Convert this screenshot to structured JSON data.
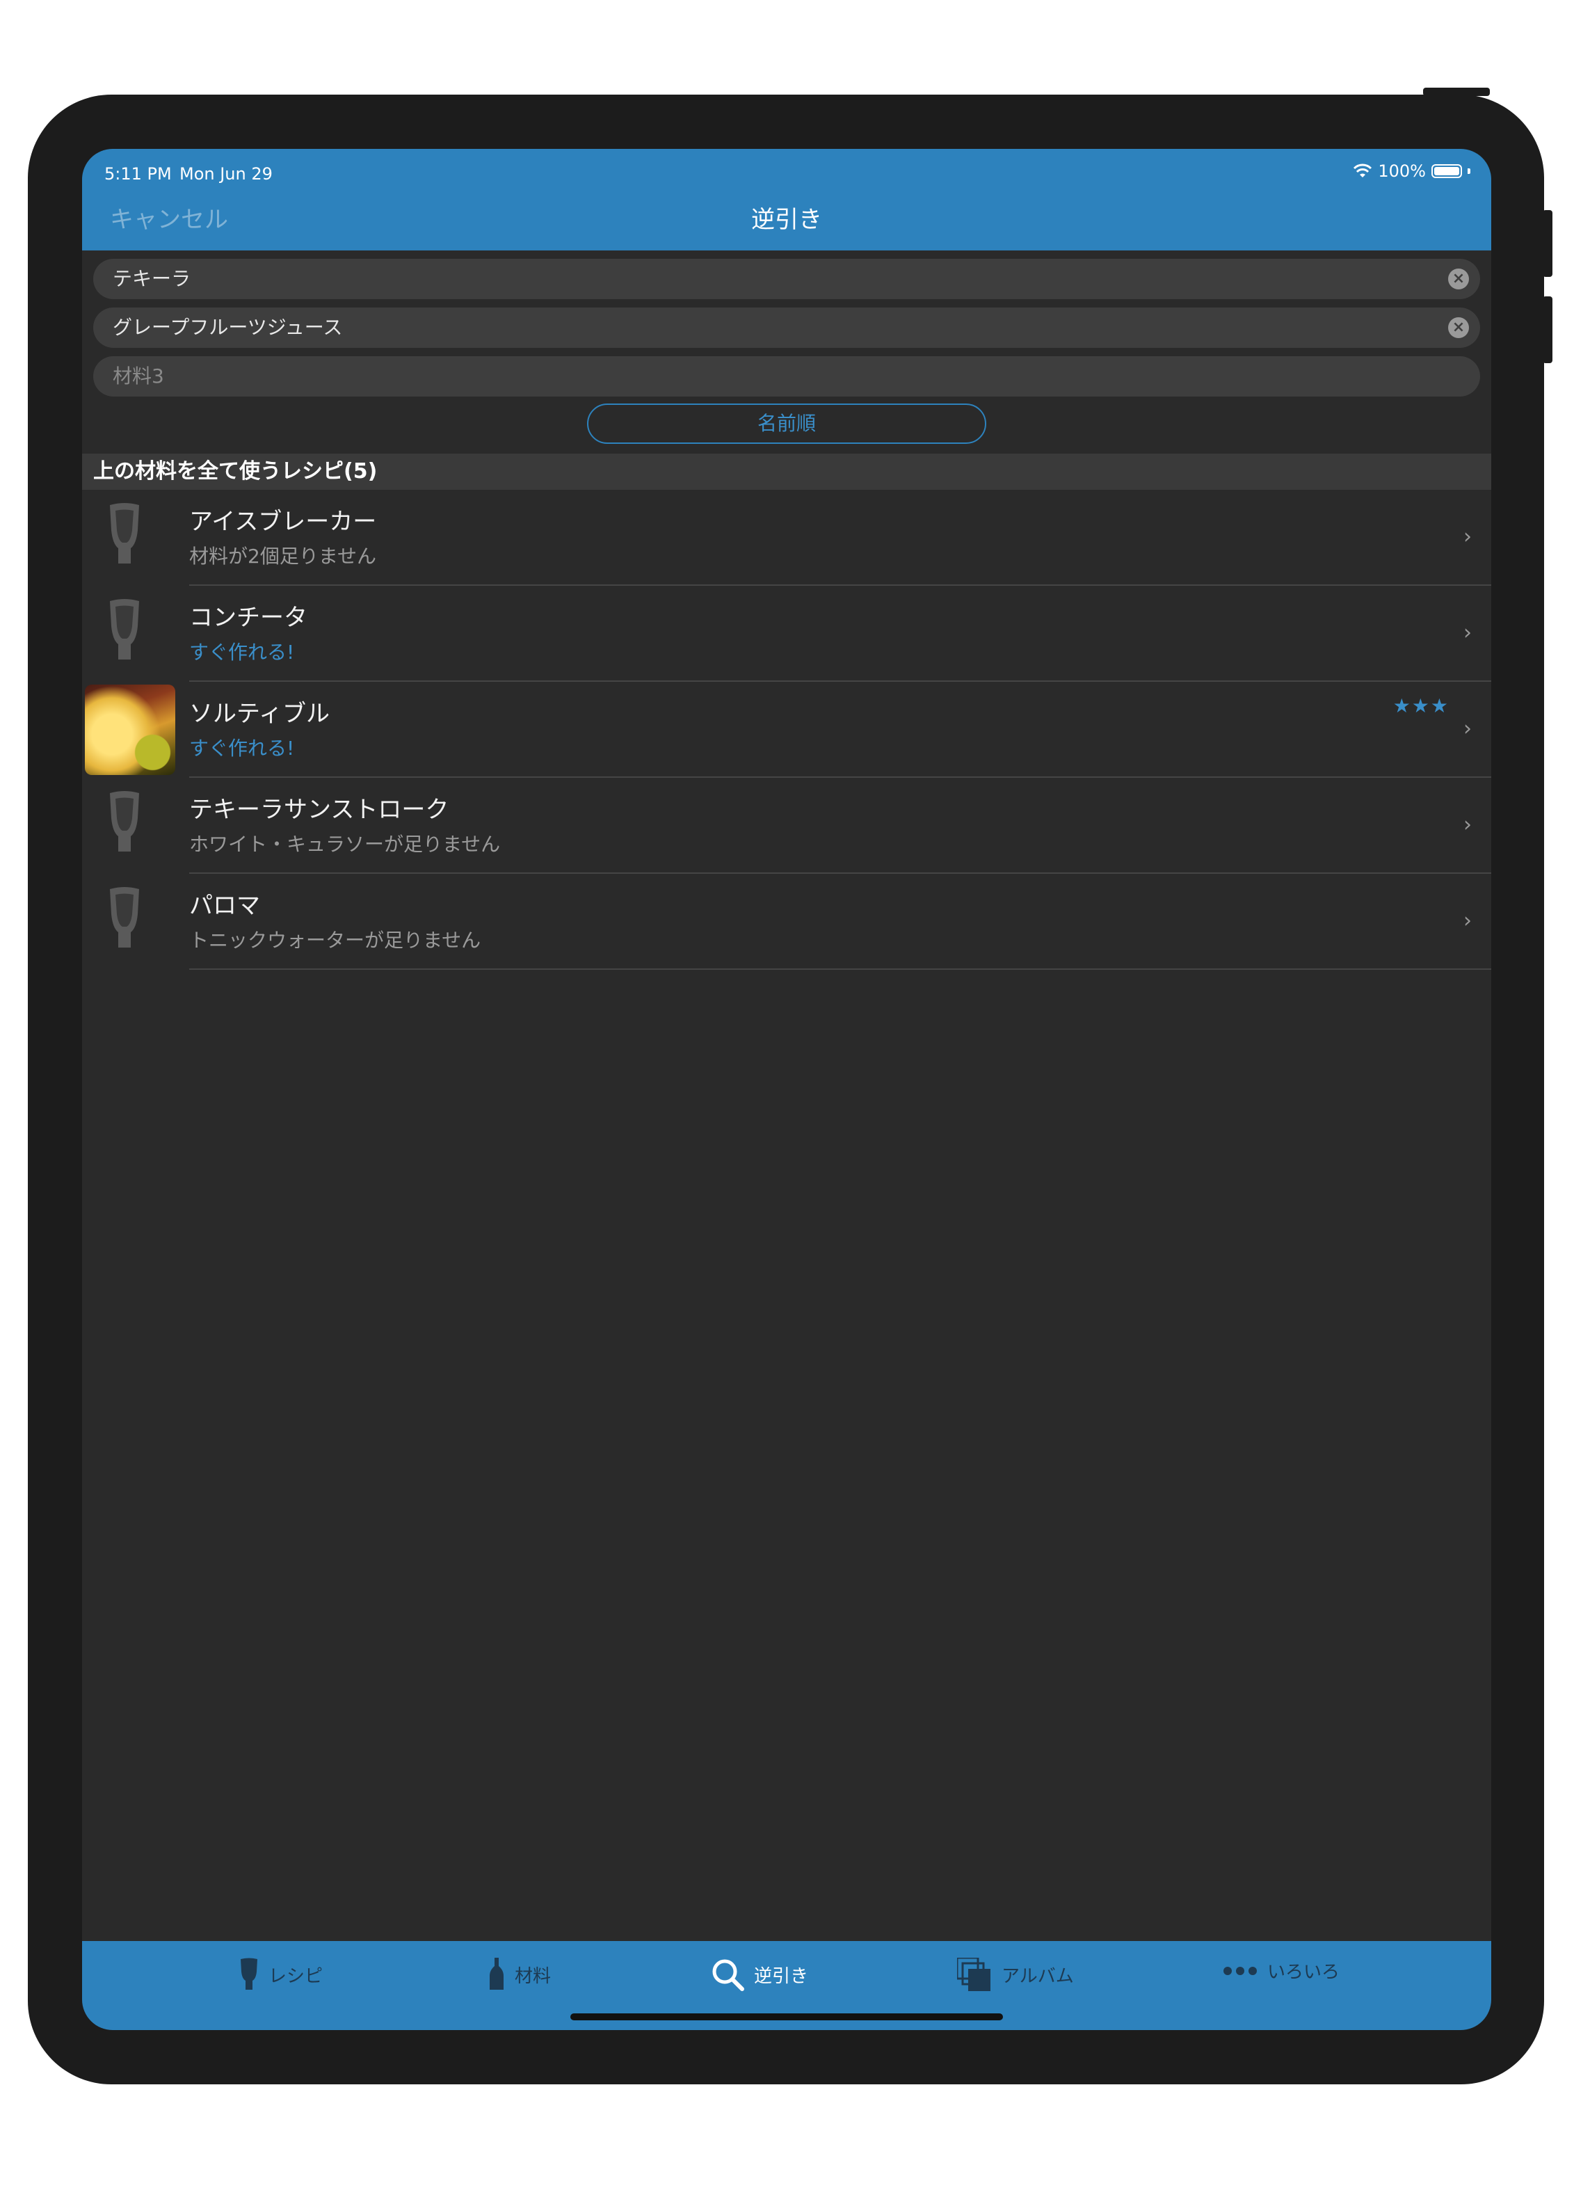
{
  "status_bar": {
    "time": "5:11 PM",
    "date": "Mon Jun 29",
    "battery": "100%"
  },
  "nav": {
    "cancel": "キャンセル",
    "title": "逆引き"
  },
  "inputs": [
    {
      "value": "テキーラ",
      "placeholder": ""
    },
    {
      "value": "グレープフルーツジュース",
      "placeholder": ""
    },
    {
      "value": "",
      "placeholder": "材料3"
    }
  ],
  "sort_button": "名前順",
  "section_header": "上の材料を全て使うレシピ(5)",
  "recipes": [
    {
      "name": "アイスブレーカー",
      "status": "材料が2個足りません",
      "ready": false,
      "stars": "",
      "photo": false
    },
    {
      "name": "コンチータ",
      "status": "すぐ作れる!",
      "ready": true,
      "stars": "",
      "photo": false
    },
    {
      "name": "ソルティブル",
      "status": "すぐ作れる!",
      "ready": true,
      "stars": "★★★",
      "photo": true
    },
    {
      "name": "テキーラサンストローク",
      "status": "ホワイト・キュラソーが足りません",
      "ready": false,
      "stars": "",
      "photo": false
    },
    {
      "name": "パロマ",
      "status": "トニックウォーターが足りません",
      "ready": false,
      "stars": "",
      "photo": false
    }
  ],
  "tabs": [
    {
      "label": "レシピ",
      "icon": "glass-icon"
    },
    {
      "label": "材料",
      "icon": "bottle-icon"
    },
    {
      "label": "逆引き",
      "icon": "search-icon"
    },
    {
      "label": "アルバム",
      "icon": "album-icon"
    },
    {
      "label": "いろいろ",
      "icon": "more-icon"
    }
  ],
  "colors": {
    "accent": "#2d82bd",
    "background": "#2a2a2a",
    "text_ready": "#3a8fca"
  }
}
